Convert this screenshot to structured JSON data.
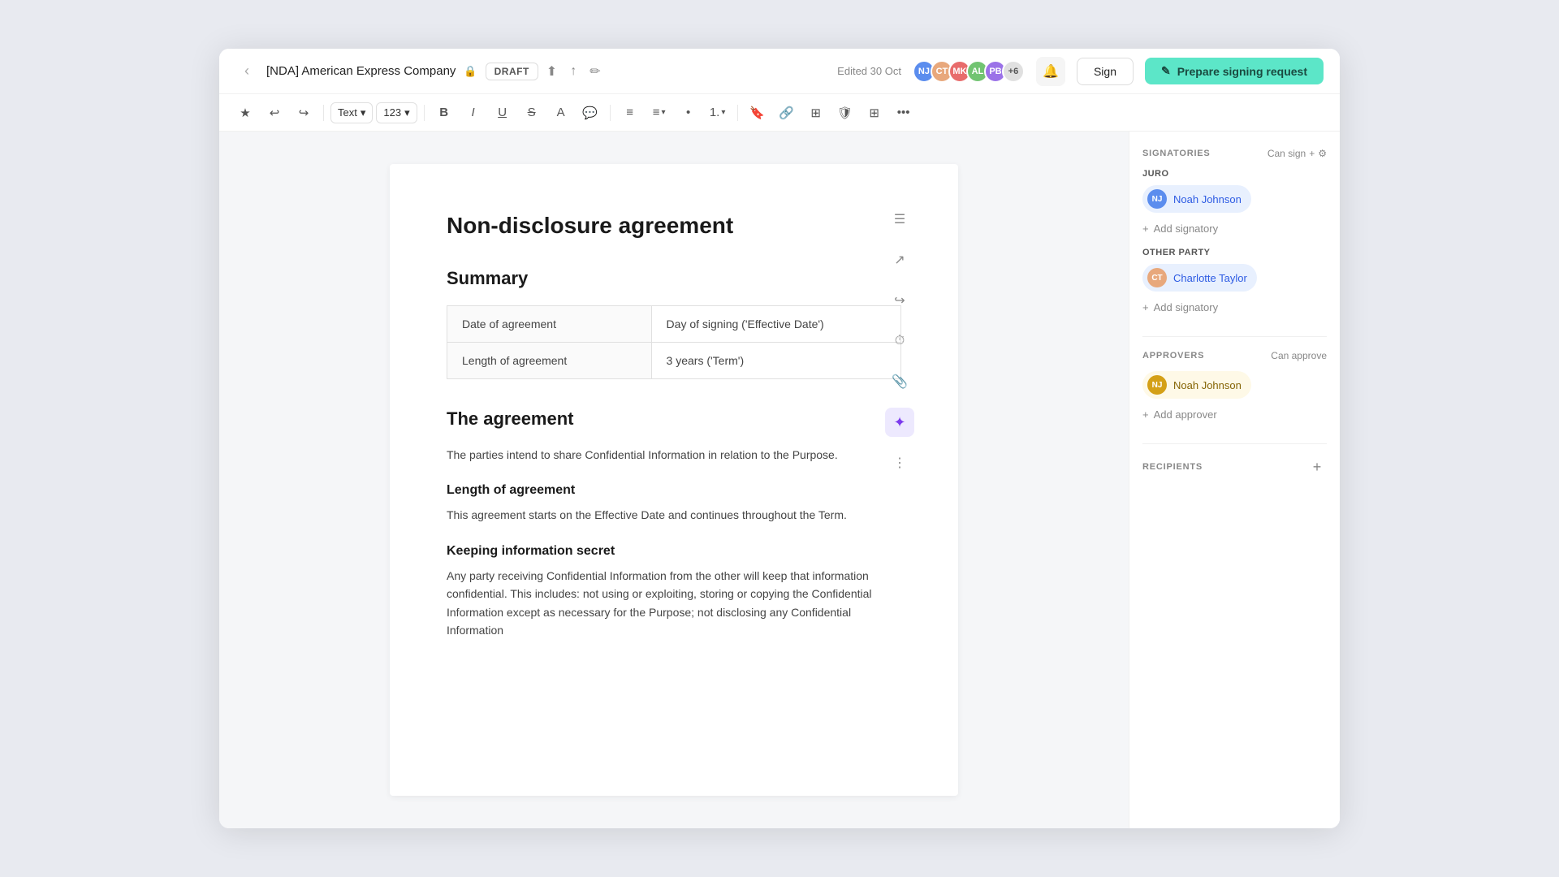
{
  "topbar": {
    "back_label": "‹",
    "title": "[NDA] American Express Company",
    "lock_icon": "🔒",
    "draft_label": "DRAFT",
    "upload_icon": "↑",
    "cloud_icon": "⬆",
    "eraser_icon": "✏",
    "edited_label": "Edited 30 Oct",
    "avatar_count": "+6",
    "bell_icon": "🔔",
    "sign_label": "Sign",
    "prepare_label": "Prepare signing request",
    "pen_icon": "✎"
  },
  "toolbar": {
    "star_icon": "★",
    "undo_icon": "↩",
    "redo_icon": "↪",
    "text_style": "Text",
    "font_size": "123",
    "bold_icon": "B",
    "italic_icon": "I",
    "underline_icon": "U",
    "strikethrough_icon": "S",
    "font_color_icon": "A",
    "comment_icon": "💬",
    "list_icon": "≡",
    "align_icon": "≡",
    "bullet_icon": "•",
    "num_list_icon": "1.",
    "bookmark_icon": "🔖",
    "link_icon": "🔗",
    "more_icon": "⋯"
  },
  "document": {
    "title": "Non-disclosure agreement",
    "summary_heading": "Summary",
    "table_rows": [
      {
        "label": "Date of agreement",
        "value": "Day of signing ('Effective Date')"
      },
      {
        "label": "Length of agreement",
        "value": "3 years ('Term')"
      }
    ],
    "agreement_heading": "The agreement",
    "agreement_text": "The parties intend to share Confidential Information in relation to the Purpose.",
    "length_heading": "Length of agreement",
    "length_text": "This agreement starts on the Effective Date and continues throughout the Term.",
    "keeping_heading": "Keeping information secret",
    "keeping_text": "Any party receiving Confidential Information from the other will keep that information confidential. This includes: not using or exploiting, storing or copying the Confidential Information except as necessary for the Purpose; not disclosing any Confidential Information"
  },
  "sidebar": {
    "signatories_title": "SIGNATORIES",
    "can_sign_label": "Can sign",
    "plus_icon": "+",
    "juro_label": "JURO",
    "noah_johnson_1": "Noah Johnson",
    "add_signatory_1": "Add signatory",
    "other_party_label": "OTHER PARTY",
    "charlotte_taylor": "Charlotte Taylor",
    "add_signatory_2": "Add signatory",
    "approvers_title": "APPROVERS",
    "can_approve_label": "Can approve",
    "noah_johnson_2": "Noah Johnson",
    "add_approver": "Add approver",
    "recipients_title": "RECIPIENTS",
    "add_recipient_icon": "+"
  },
  "avatars": [
    {
      "initials": "NJ",
      "color": "#5b8dee"
    },
    {
      "initials": "CT",
      "color": "#e8a87c"
    },
    {
      "initials": "MK",
      "color": "#e86c6c"
    },
    {
      "initials": "AL",
      "color": "#72c472"
    },
    {
      "initials": "PB",
      "color": "#9b72e8"
    }
  ]
}
